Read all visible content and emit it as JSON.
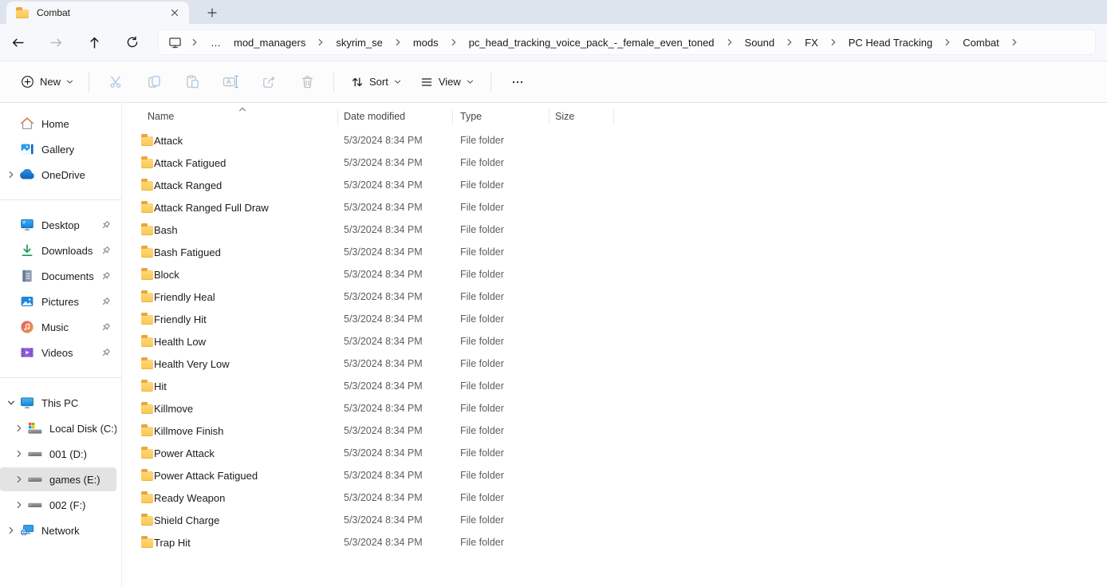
{
  "tab": {
    "title": "Combat"
  },
  "breadcrumb": {
    "overflow": "…",
    "segments": [
      "mod_managers",
      "skyrim_se",
      "mods",
      "pc_head_tracking_voice_pack_-_female_even_toned",
      "Sound",
      "FX",
      "PC Head Tracking",
      "Combat"
    ]
  },
  "toolbar": {
    "new_label": "New",
    "sort_label": "Sort",
    "view_label": "View",
    "icons": [
      "cut-icon",
      "copy-icon",
      "paste-icon",
      "rename-icon",
      "share-icon",
      "delete-icon"
    ],
    "more_icon": "more-options-icon"
  },
  "sidebar": {
    "items": [
      {
        "label": "Home",
        "icon": "home-icon"
      },
      {
        "label": "Gallery",
        "icon": "gallery-icon"
      },
      {
        "label": "OneDrive",
        "icon": "onedrive-icon",
        "chevron": "right"
      },
      {
        "type": "divider"
      },
      {
        "label": "Desktop",
        "icon": "desktop-icon",
        "pinned": true
      },
      {
        "label": "Downloads",
        "icon": "downloads-icon",
        "pinned": true
      },
      {
        "label": "Documents",
        "icon": "documents-icon",
        "pinned": true
      },
      {
        "label": "Pictures",
        "icon": "pictures-icon",
        "pinned": true
      },
      {
        "label": "Music",
        "icon": "music-icon",
        "pinned": true
      },
      {
        "label": "Videos",
        "icon": "videos-icon",
        "pinned": true
      },
      {
        "type": "divider"
      },
      {
        "label": "This PC",
        "icon": "this-pc-icon",
        "chevron": "down"
      },
      {
        "label": "Local Disk (C:)",
        "icon": "local-disk-icon",
        "chevron": "right",
        "indent": 1
      },
      {
        "label": "001 (D:)",
        "icon": "drive-icon",
        "chevron": "right",
        "indent": 1
      },
      {
        "label": "games (E:)",
        "icon": "drive-icon",
        "chevron": "right",
        "indent": 1,
        "selected": true
      },
      {
        "label": "002 (F:)",
        "icon": "drive-icon",
        "chevron": "right",
        "indent": 1
      },
      {
        "label": "Network",
        "icon": "network-icon",
        "chevron": "right"
      }
    ]
  },
  "list": {
    "columns": [
      "Name",
      "Date modified",
      "Type",
      "Size"
    ],
    "sort": {
      "column": "Name",
      "direction": "ascending"
    },
    "rows": [
      {
        "name": "Attack",
        "date_modified": "5/3/2024 8:34 PM",
        "type": "File folder",
        "size": ""
      },
      {
        "name": "Attack Fatigued",
        "date_modified": "5/3/2024 8:34 PM",
        "type": "File folder",
        "size": ""
      },
      {
        "name": "Attack Ranged",
        "date_modified": "5/3/2024 8:34 PM",
        "type": "File folder",
        "size": ""
      },
      {
        "name": "Attack Ranged Full Draw",
        "date_modified": "5/3/2024 8:34 PM",
        "type": "File folder",
        "size": ""
      },
      {
        "name": "Bash",
        "date_modified": "5/3/2024 8:34 PM",
        "type": "File folder",
        "size": ""
      },
      {
        "name": "Bash Fatigued",
        "date_modified": "5/3/2024 8:34 PM",
        "type": "File folder",
        "size": ""
      },
      {
        "name": "Block",
        "date_modified": "5/3/2024 8:34 PM",
        "type": "File folder",
        "size": ""
      },
      {
        "name": "Friendly Heal",
        "date_modified": "5/3/2024 8:34 PM",
        "type": "File folder",
        "size": ""
      },
      {
        "name": "Friendly Hit",
        "date_modified": "5/3/2024 8:34 PM",
        "type": "File folder",
        "size": ""
      },
      {
        "name": "Health Low",
        "date_modified": "5/3/2024 8:34 PM",
        "type": "File folder",
        "size": ""
      },
      {
        "name": "Health Very Low",
        "date_modified": "5/3/2024 8:34 PM",
        "type": "File folder",
        "size": ""
      },
      {
        "name": "Hit",
        "date_modified": "5/3/2024 8:34 PM",
        "type": "File folder",
        "size": ""
      },
      {
        "name": "Killmove",
        "date_modified": "5/3/2024 8:34 PM",
        "type": "File folder",
        "size": ""
      },
      {
        "name": "Killmove Finish",
        "date_modified": "5/3/2024 8:34 PM",
        "type": "File folder",
        "size": ""
      },
      {
        "name": "Power Attack",
        "date_modified": "5/3/2024 8:34 PM",
        "type": "File folder",
        "size": ""
      },
      {
        "name": "Power Attack Fatigued",
        "date_modified": "5/3/2024 8:34 PM",
        "type": "File folder",
        "size": ""
      },
      {
        "name": "Ready Weapon",
        "date_modified": "5/3/2024 8:34 PM",
        "type": "File folder",
        "size": ""
      },
      {
        "name": "Shield Charge",
        "date_modified": "5/3/2024 8:34 PM",
        "type": "File folder",
        "size": ""
      },
      {
        "name": "Trap Hit",
        "date_modified": "5/3/2024 8:34 PM",
        "type": "File folder",
        "size": ""
      }
    ]
  },
  "colors": {
    "tab_strip_bg": "#dee4ee",
    "chrome_bg": "#f6f8fb",
    "toolbar_bg": "#fcfcfd",
    "content_bg": "#ffffff",
    "selected_item_bg": "#e3e3e3",
    "folder_icon_front": "#ffd36e",
    "folder_icon_back": "#e9a63f",
    "text_primary": "#1b1b1b",
    "text_secondary": "#5e5e5e"
  }
}
